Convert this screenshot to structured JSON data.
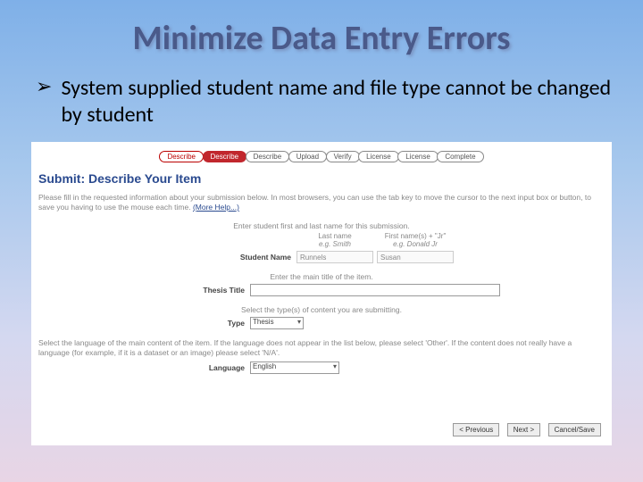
{
  "title": "Minimize Data Entry Errors",
  "bullet": "System supplied student name and file type cannot be changed by student",
  "crumbs": {
    "c1": "Describe",
    "c2": "Describe",
    "c3": "Describe",
    "c4": "Upload",
    "c5": "Verify",
    "c6": "License",
    "c7": "License",
    "c8": "Complete"
  },
  "form": {
    "heading": "Submit: Describe Your Item",
    "intro": "Please fill in the requested information about your submission below. In most browsers, you can use the tab key to move the cursor to the next input box or button, to save you having to use the mouse each time.",
    "morehelp": "(More Help...)",
    "nameHint": "Enter student first and last name for this submission.",
    "colLast": "Last name",
    "colFirst": "First name(s) + \"Jr\"",
    "egLast": "e.g. Smith",
    "egFirst": "e.g. Donald Jr",
    "studentNameLabel": "Student Name",
    "studentLast": "Runnels",
    "studentFirst": "Susan",
    "titleHint": "Enter the main title of the item.",
    "thesisTitleLabel": "Thesis Title",
    "typeHint": "Select the type(s) of content you are submitting.",
    "typeLabel": "Type",
    "typeValue": "Thesis",
    "langHint": "Select the language of the main content of the item. If the language does not appear in the list below, please select 'Other'. If the content does not really have a language (for example, if it is a dataset or an image) please select 'N/A'.",
    "languageLabel": "Language",
    "languageValue": "English",
    "btnPrev": "< Previous",
    "btnNext": "Next >",
    "btnCancel": "Cancel/Save"
  }
}
